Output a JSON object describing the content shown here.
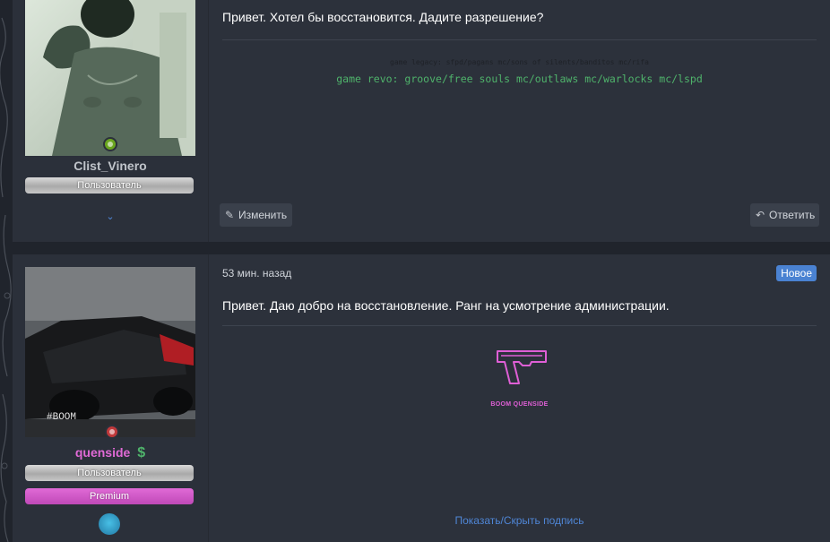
{
  "posts": [
    {
      "author": {
        "username": "Clist_Vinero",
        "username_color": "#c0c4ca",
        "role": "Пользователь",
        "status_color": "#6aa61e"
      },
      "message": "Привет. Хотел бы восстановится. Дадите разрешение?",
      "signature": {
        "legacy_line": "game legacy: sfpd/pagans mc/sons of silents/banditos mc/rifa",
        "revo_line": "game revo: groove/free souls mc/outlaws mc/warlocks mc/lspd"
      },
      "actions": {
        "edit_label": "Изменить",
        "reply_label": "Ответить"
      }
    },
    {
      "author": {
        "username": "quenside",
        "username_color": "#e06ad6",
        "role": "Пользователь",
        "premium_role": "Premium",
        "status_color": "#c0393b",
        "currency_symbol": "$",
        "avatar_watermark": "#BOOM"
      },
      "time": "53 мин. назад",
      "badge": "Новое",
      "message": "Привет. Даю добро на восстановление. Ранг на усмотрение администрации.",
      "signature": {
        "brand": "BOOM QUENSIDE",
        "toggle_label": "Показать/Скрыть подпись"
      }
    }
  ],
  "colors": {
    "accent": "#4f86d6",
    "new_badge": "#4a82d2",
    "signature_green": "#4fb36b",
    "signature_pink": "#df5fd6"
  }
}
